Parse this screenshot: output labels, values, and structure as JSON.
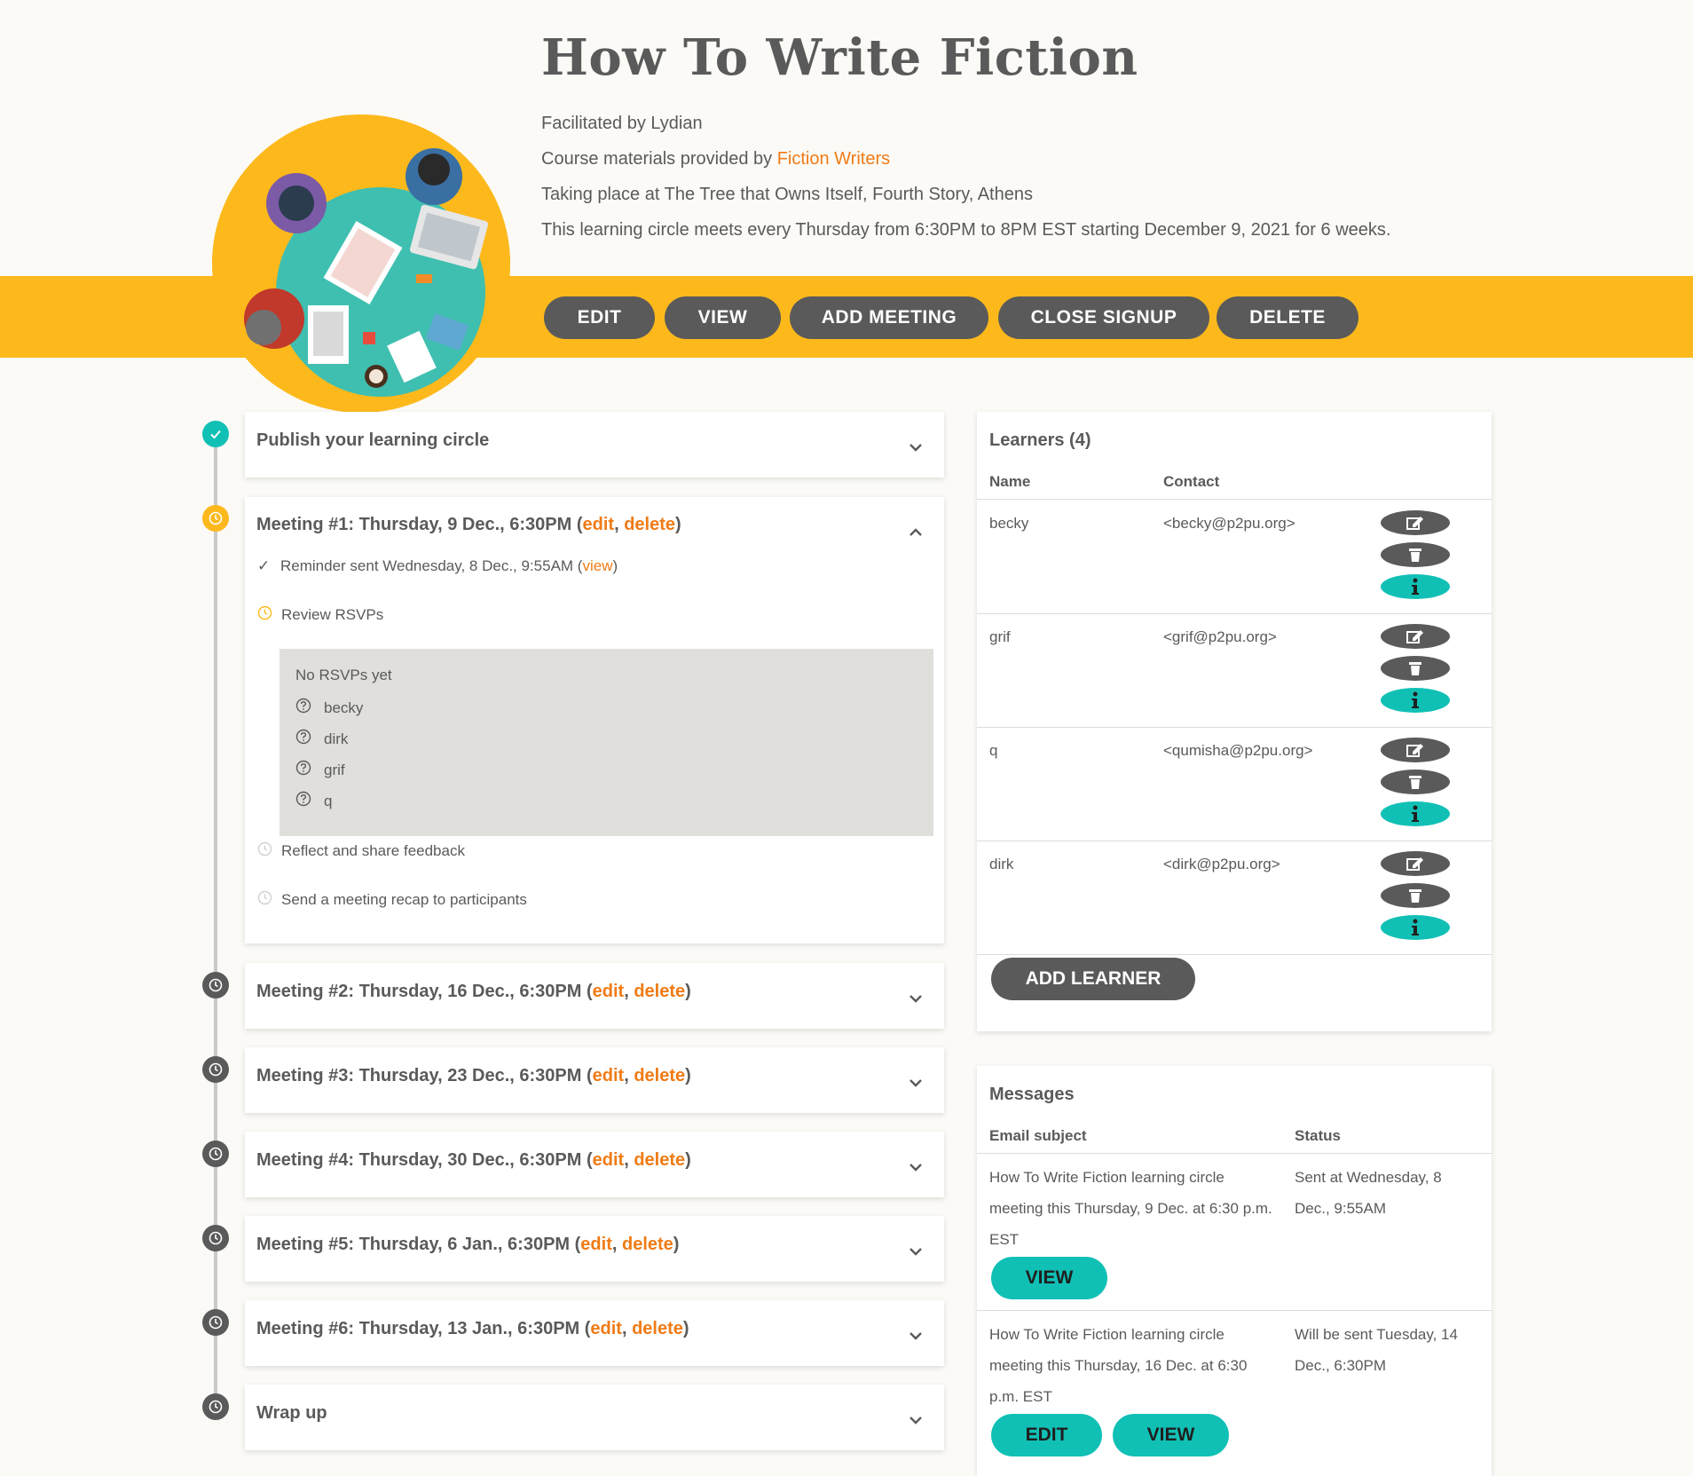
{
  "header": {
    "title": "How To Write Fiction",
    "facilitated": "Facilitated by Lydian",
    "materials_prefix": "Course materials provided by ",
    "materials_link": "Fiction Writers",
    "location": "Taking place at The Tree that Owns Itself, Fourth Story, Athens",
    "schedule": "This learning circle meets every Thursday from 6:30PM to 8PM EST starting December 9, 2021 for 6 weeks."
  },
  "actions": {
    "edit": "EDIT",
    "view": "VIEW",
    "add_meeting": "ADD MEETING",
    "close_signup": "CLOSE SIGNUP",
    "delete": "DELETE"
  },
  "timeline": {
    "publish": "Publish your learning circle",
    "meeting1": {
      "title": "Meeting #1: Thursday, 9 Dec., 6:30PM (",
      "edit": "edit",
      "sep": ", ",
      "delete": "delete",
      "close": ")",
      "reminder_prefix": "Reminder sent Wednesday, 8 Dec., 9:55AM (",
      "reminder_link": "view",
      "reminder_suffix": ")",
      "review": "Review RSVPs",
      "no_rsvps": "No RSVPs yet",
      "rsvp_names": [
        "becky",
        "dirk",
        "grif",
        "q"
      ],
      "reflect": "Reflect and share feedback",
      "recap": "Send a meeting recap to participants"
    },
    "meetings": [
      {
        "title": "Meeting #2: Thursday, 16 Dec., 6:30PM ("
      },
      {
        "title": "Meeting #3: Thursday, 23 Dec., 6:30PM ("
      },
      {
        "title": "Meeting #4: Thursday, 30 Dec., 6:30PM ("
      },
      {
        "title": "Meeting #5: Thursday, 6 Jan., 6:30PM ("
      },
      {
        "title": "Meeting #6: Thursday, 13 Jan., 6:30PM ("
      }
    ],
    "edit_label": "edit",
    "delete_label": "delete",
    "sep": ", ",
    "close": ")",
    "wrapup": "Wrap up"
  },
  "learners": {
    "title": "Learners (4)",
    "col_name": "Name",
    "col_contact": "Contact",
    "rows": [
      {
        "name": "becky",
        "contact": "<becky@p2pu.org>"
      },
      {
        "name": "grif",
        "contact": "<grif@p2pu.org>"
      },
      {
        "name": "q",
        "contact": "<qumisha@p2pu.org>"
      },
      {
        "name": "dirk",
        "contact": "<dirk@p2pu.org>"
      }
    ],
    "add_button": "ADD LEARNER"
  },
  "messages": {
    "title": "Messages",
    "col_subject": "Email subject",
    "col_status": "Status",
    "rows": [
      {
        "subject": "How To Write Fiction learning circle meeting this Thursday, 9 Dec. at 6:30 p.m. EST",
        "status": "Sent at Wednesday, 8 Dec., 9:55AM",
        "view": "VIEW"
      },
      {
        "subject": "How To Write Fiction learning circle meeting this Thursday, 16 Dec. at 6:30 p.m. EST",
        "status": "Will be sent Tuesday, 14 Dec., 6:30PM",
        "edit": "EDIT",
        "view": "VIEW"
      }
    ]
  },
  "colors": {
    "accent_yellow": "#fdb91c",
    "accent_teal": "#11c0b5",
    "link_orange": "#f07b15",
    "dark_gray": "#5a5a5a"
  }
}
